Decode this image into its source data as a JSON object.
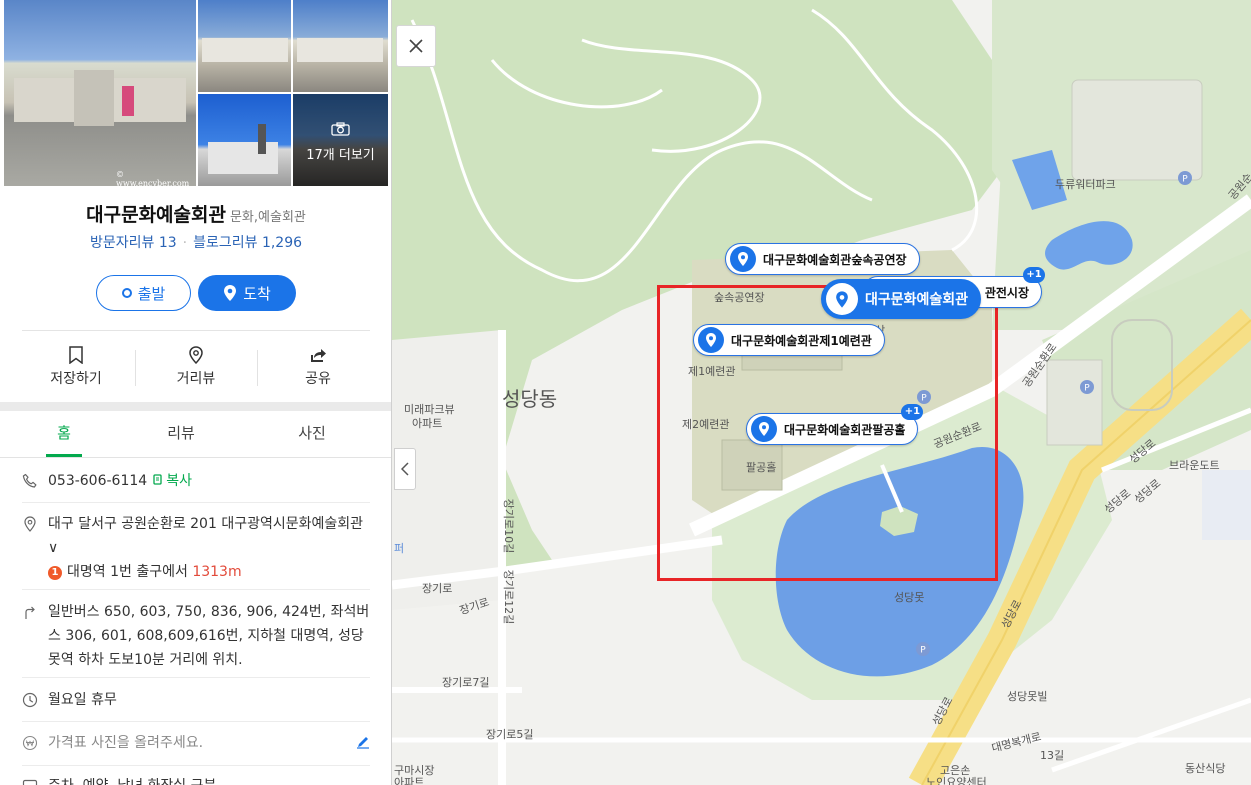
{
  "place": {
    "name": "대구문화예술회관",
    "category": "문화,예술회관",
    "visitor_reviews": "방문자리뷰 13",
    "blog_reviews": "블로그리뷰 1,296",
    "photo_watermark": "© www.encyber.com",
    "more_photos": "17개 더보기"
  },
  "route": {
    "depart": "출발",
    "arrive": "도착"
  },
  "actions": {
    "save": "저장하기",
    "street_view": "거리뷰",
    "share": "공유"
  },
  "tabs": [
    {
      "label": "홈",
      "active": true
    },
    {
      "label": "리뷰"
    },
    {
      "label": "사진"
    }
  ],
  "info": {
    "phone": "053-606-6114",
    "copy": "복사",
    "address": "대구 달서구 공원순환로 201 대구광역시문화예술회관",
    "address_toggle": "∨",
    "subway_badge": "1",
    "subway": "대명역 1번 출구에서",
    "subway_distance": "1313m",
    "transit": "일반버스 650, 603, 750, 836, 906, 424번, 좌석버스 306, 601, 608,609,616번, 지하철 대명역, 성당못역 하차 도보10분 거리에 위치.",
    "hours": "월요일 휴무",
    "price_placeholder": "가격표 사진을 올려주세요.",
    "last_row": "주차, 예약, 남녀 화장실 구분"
  },
  "map": {
    "dong": "성당동",
    "pins": {
      "outdoor_stage": "대구문화예술회관숲속공연장",
      "main": "대구문화예술회관",
      "hall_partial": "관전시장",
      "hall_plus": "+1",
      "gallery1": "대구문화예술회관제1예련관",
      "palgong": "대구문화예술회관팔공홀",
      "palgong_plus": "+1"
    },
    "labels": {
      "outdoor_stage": "숲속공연장",
      "gallery1": "제1예련관",
      "gallery2": "제2예련관",
      "palgong": "팔공홀",
      "pond": "성당못",
      "waterpark": "두류워터파크",
      "apt": "미래파크뷰",
      "apt2": "아파트",
      "park_road": "공원순환로",
      "park_road2": "공원순환로",
      "park_road3": "공원순",
      "sungdang1": "성당로",
      "sungdang2": "성당로",
      "sungdang3": "성당로",
      "sungdang4": "성당로",
      "sungdang5": "성당로",
      "jangki1": "장기로",
      "jangki2": "장기로",
      "jangki7": "장기로7길",
      "jangki5": "장기로5길",
      "jangki10": "장기로10길",
      "jangki12": "장기로12길",
      "brown": "브라운도트",
      "sungdang_villa": "성당못빌",
      "daemyeong": "대명복개로",
      "gil13": "13길",
      "goeunson": "고은손",
      "nursing": "노인요양센터",
      "dongsan": "동산식당",
      "market": "구마시장",
      "apt3": "아파트",
      "gongwon_edge": "공원",
      "sang": "상",
      "peo": "퍼"
    }
  }
}
